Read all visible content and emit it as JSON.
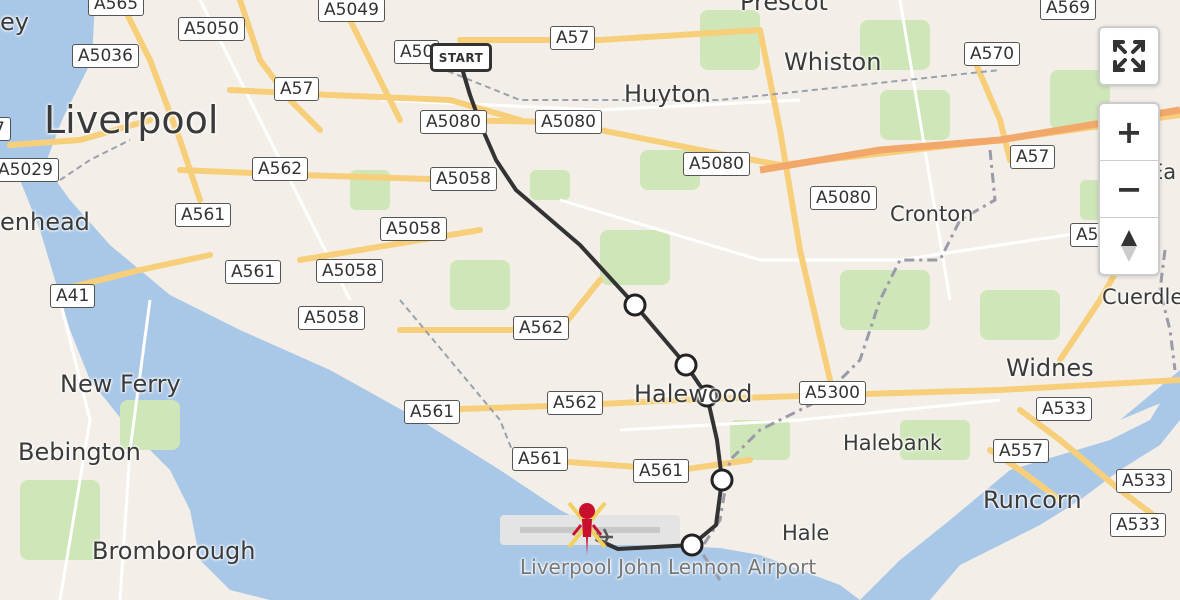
{
  "map": {
    "places": [
      {
        "id": "prescot",
        "label": "Prescot",
        "kind": "town"
      },
      {
        "id": "whiston",
        "label": "Whiston",
        "kind": "town"
      },
      {
        "id": "huyton",
        "label": "Huyton",
        "kind": "town"
      },
      {
        "id": "liverpool",
        "label": "Liverpool",
        "kind": "city"
      },
      {
        "id": "cronton",
        "label": "Cronton",
        "kind": "small"
      },
      {
        "id": "birkenhead",
        "label": "enhead",
        "kind": "town"
      },
      {
        "id": "new-ferry",
        "label": "New Ferry",
        "kind": "town"
      },
      {
        "id": "bebington",
        "label": "Bebington",
        "kind": "town"
      },
      {
        "id": "bromborough",
        "label": "Bromborough",
        "kind": "town"
      },
      {
        "id": "halewood",
        "label": "Halewood",
        "kind": "town"
      },
      {
        "id": "halebank",
        "label": "Halebank",
        "kind": "small"
      },
      {
        "id": "widnes",
        "label": "Widnes",
        "kind": "town"
      },
      {
        "id": "runcorn",
        "label": "Runcorn",
        "kind": "town"
      },
      {
        "id": "hale",
        "label": "Hale",
        "kind": "small"
      },
      {
        "id": "cuerdley",
        "label": "Cuerdle",
        "kind": "small"
      },
      {
        "id": "east-edge",
        "label": "Ea",
        "kind": "small"
      },
      {
        "id": "west-edge",
        "label": "ey",
        "kind": "town"
      },
      {
        "id": "airport",
        "label": "Liverpool John Lennon Airport",
        "kind": "airport"
      }
    ],
    "road_shields": [
      {
        "id": "a565",
        "label": "A565"
      },
      {
        "id": "a5050",
        "label": "A5050"
      },
      {
        "id": "a5049",
        "label": "A5049"
      },
      {
        "id": "a5036",
        "label": "A5036"
      },
      {
        "id": "a50-start",
        "label": "A50"
      },
      {
        "id": "a57-top",
        "label": "A57"
      },
      {
        "id": "a57-left",
        "label": "A57"
      },
      {
        "id": "a569",
        "label": "A569"
      },
      {
        "id": "a570",
        "label": "A570"
      },
      {
        "id": "a5080-1",
        "label": "A5080"
      },
      {
        "id": "a5080-2",
        "label": "A5080"
      },
      {
        "id": "a5080-3",
        "label": "A5080"
      },
      {
        "id": "a5080-4",
        "label": "A5080"
      },
      {
        "id": "a5029",
        "label": "A5029"
      },
      {
        "id": "a562-1",
        "label": "A562"
      },
      {
        "id": "a5058-1",
        "label": "A5058"
      },
      {
        "id": "a561-1",
        "label": "A561"
      },
      {
        "id": "a5058-2",
        "label": "A5058"
      },
      {
        "id": "a561-2",
        "label": "A561"
      },
      {
        "id": "a5058-3",
        "label": "A5058"
      },
      {
        "id": "a41",
        "label": "A41"
      },
      {
        "id": "a5058-4",
        "label": "A5058"
      },
      {
        "id": "a562-2",
        "label": "A562"
      },
      {
        "id": "a561-3",
        "label": "A561"
      },
      {
        "id": "a562-3",
        "label": "A562"
      },
      {
        "id": "a561-4",
        "label": "A561"
      },
      {
        "id": "a561-5",
        "label": "A561"
      },
      {
        "id": "a5300",
        "label": "A5300"
      },
      {
        "id": "a533-1",
        "label": "A533"
      },
      {
        "id": "a557",
        "label": "A557"
      },
      {
        "id": "a533-2",
        "label": "A533"
      },
      {
        "id": "a533-3",
        "label": "A533"
      },
      {
        "id": "a57-right",
        "label": "A57"
      },
      {
        "id": "a5-edge",
        "label": "A5"
      },
      {
        "id": "a-edge",
        "label": "7"
      }
    ],
    "route": {
      "start_label": "START",
      "waypoints": 5,
      "color": "#333333"
    },
    "destination": {
      "icon": "red-person-icon"
    },
    "colors": {
      "water": "#a9c8e8",
      "land": "#f3efe8",
      "green": "#cfe6b8",
      "main_road": "#f7cf7a",
      "route": "#333333",
      "boundary": "#9a9aa8"
    }
  },
  "controls": {
    "fullscreen": {
      "icon": "fullscreen-icon"
    },
    "zoom_in": {
      "icon": "zoom-in-icon",
      "label": "+"
    },
    "zoom_out": {
      "icon": "zoom-out-icon",
      "label": "−"
    },
    "reset_north": {
      "icon": "compass-icon"
    }
  }
}
